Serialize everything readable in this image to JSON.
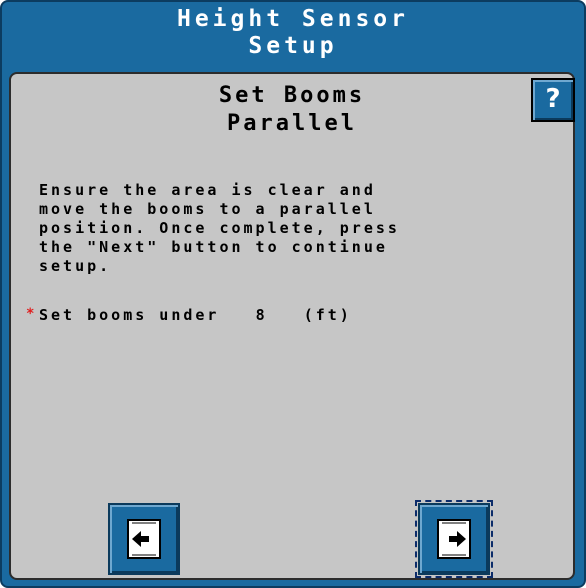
{
  "header": {
    "title_line1": "Height Sensor",
    "title_line2": "Setup"
  },
  "help": {
    "label": "?"
  },
  "step": {
    "heading_line1": "Set Booms",
    "heading_line2": "Parallel"
  },
  "instructions": [
    "Ensure the area is clear and",
    "move the booms to a parallel",
    "position. Once complete, press",
    "the \"Next\" button to continue",
    "setup."
  ],
  "boom_height": {
    "required_marker": "*",
    "label": "Set booms under",
    "value": "8",
    "unit": "(ft)"
  },
  "navigation": {
    "back_icon": "back-page-icon",
    "next_icon": "next-page-icon"
  },
  "colors": {
    "frame": "#1a6aa0",
    "panel": "#c6c6c6",
    "required": "#e02020"
  }
}
